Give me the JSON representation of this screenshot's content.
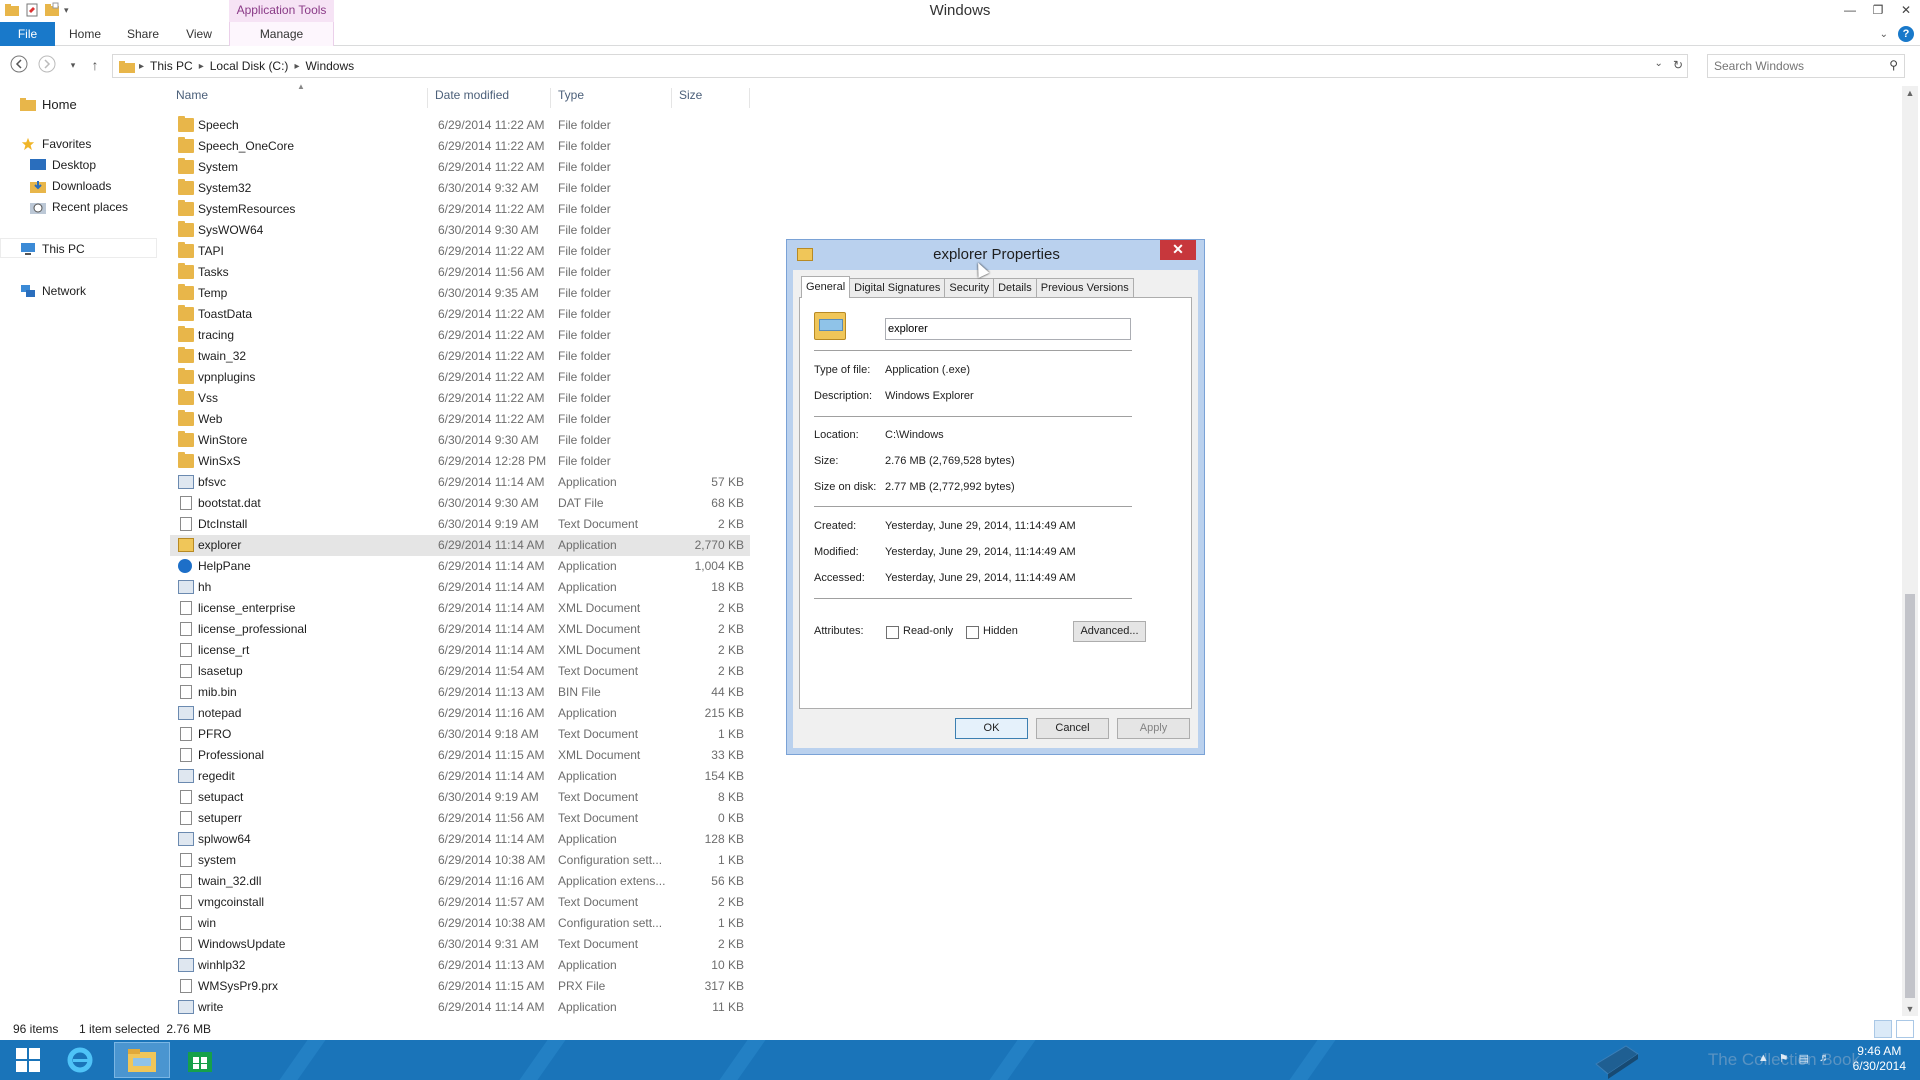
{
  "window": {
    "title": "Windows",
    "contextual_tab_group": "Application Tools"
  },
  "ribbon": {
    "tabs": [
      "File",
      "Home",
      "Share",
      "View",
      "Manage"
    ]
  },
  "address": {
    "crumbs": [
      "This PC",
      "Local Disk (C:)",
      "Windows"
    ],
    "search_placeholder": "Search Windows"
  },
  "nav": {
    "home": "Home",
    "favorites": "Favorites",
    "desktop": "Desktop",
    "downloads": "Downloads",
    "recent": "Recent places",
    "thispc": "This PC",
    "network": "Network"
  },
  "columns": {
    "name": "Name",
    "date": "Date modified",
    "type": "Type",
    "size": "Size"
  },
  "files": [
    {
      "name": "Speech",
      "date": "6/29/2014 11:22 AM",
      "type": "File folder",
      "size": "",
      "icon": "folder"
    },
    {
      "name": "Speech_OneCore",
      "date": "6/29/2014 11:22 AM",
      "type": "File folder",
      "size": "",
      "icon": "folder"
    },
    {
      "name": "System",
      "date": "6/29/2014 11:22 AM",
      "type": "File folder",
      "size": "",
      "icon": "folder"
    },
    {
      "name": "System32",
      "date": "6/30/2014 9:32 AM",
      "type": "File folder",
      "size": "",
      "icon": "folder"
    },
    {
      "name": "SystemResources",
      "date": "6/29/2014 11:22 AM",
      "type": "File folder",
      "size": "",
      "icon": "folder"
    },
    {
      "name": "SysWOW64",
      "date": "6/30/2014 9:30 AM",
      "type": "File folder",
      "size": "",
      "icon": "folder"
    },
    {
      "name": "TAPI",
      "date": "6/29/2014 11:22 AM",
      "type": "File folder",
      "size": "",
      "icon": "folder"
    },
    {
      "name": "Tasks",
      "date": "6/29/2014 11:56 AM",
      "type": "File folder",
      "size": "",
      "icon": "folder"
    },
    {
      "name": "Temp",
      "date": "6/30/2014 9:35 AM",
      "type": "File folder",
      "size": "",
      "icon": "folder"
    },
    {
      "name": "ToastData",
      "date": "6/29/2014 11:22 AM",
      "type": "File folder",
      "size": "",
      "icon": "folder"
    },
    {
      "name": "tracing",
      "date": "6/29/2014 11:22 AM",
      "type": "File folder",
      "size": "",
      "icon": "folder"
    },
    {
      "name": "twain_32",
      "date": "6/29/2014 11:22 AM",
      "type": "File folder",
      "size": "",
      "icon": "folder"
    },
    {
      "name": "vpnplugins",
      "date": "6/29/2014 11:22 AM",
      "type": "File folder",
      "size": "",
      "icon": "folder"
    },
    {
      "name": "Vss",
      "date": "6/29/2014 11:22 AM",
      "type": "File folder",
      "size": "",
      "icon": "folder"
    },
    {
      "name": "Web",
      "date": "6/29/2014 11:22 AM",
      "type": "File folder",
      "size": "",
      "icon": "folder"
    },
    {
      "name": "WinStore",
      "date": "6/30/2014 9:30 AM",
      "type": "File folder",
      "size": "",
      "icon": "folder"
    },
    {
      "name": "WinSxS",
      "date": "6/29/2014 12:28 PM",
      "type": "File folder",
      "size": "",
      "icon": "folder"
    },
    {
      "name": "bfsvc",
      "date": "6/29/2014 11:14 AM",
      "type": "Application",
      "size": "57 KB",
      "icon": "app"
    },
    {
      "name": "bootstat.dat",
      "date": "6/30/2014 9:30 AM",
      "type": "DAT File",
      "size": "68 KB",
      "icon": "doc"
    },
    {
      "name": "DtcInstall",
      "date": "6/30/2014 9:19 AM",
      "type": "Text Document",
      "size": "2 KB",
      "icon": "doc"
    },
    {
      "name": "explorer",
      "date": "6/29/2014 11:14 AM",
      "type": "Application",
      "size": "2,770 KB",
      "icon": "explorer",
      "selected": true
    },
    {
      "name": "HelpPane",
      "date": "6/29/2014 11:14 AM",
      "type": "Application",
      "size": "1,004 KB",
      "icon": "help"
    },
    {
      "name": "hh",
      "date": "6/29/2014 11:14 AM",
      "type": "Application",
      "size": "18 KB",
      "icon": "app"
    },
    {
      "name": "license_enterprise",
      "date": "6/29/2014 11:14 AM",
      "type": "XML Document",
      "size": "2 KB",
      "icon": "doc"
    },
    {
      "name": "license_professional",
      "date": "6/29/2014 11:14 AM",
      "type": "XML Document",
      "size": "2 KB",
      "icon": "doc"
    },
    {
      "name": "license_rt",
      "date": "6/29/2014 11:14 AM",
      "type": "XML Document",
      "size": "2 KB",
      "icon": "doc"
    },
    {
      "name": "lsasetup",
      "date": "6/29/2014 11:54 AM",
      "type": "Text Document",
      "size": "2 KB",
      "icon": "doc"
    },
    {
      "name": "mib.bin",
      "date": "6/29/2014 11:13 AM",
      "type": "BIN File",
      "size": "44 KB",
      "icon": "doc"
    },
    {
      "name": "notepad",
      "date": "6/29/2014 11:16 AM",
      "type": "Application",
      "size": "215 KB",
      "icon": "app"
    },
    {
      "name": "PFRO",
      "date": "6/30/2014 9:18 AM",
      "type": "Text Document",
      "size": "1 KB",
      "icon": "doc"
    },
    {
      "name": "Professional",
      "date": "6/29/2014 11:15 AM",
      "type": "XML Document",
      "size": "33 KB",
      "icon": "doc"
    },
    {
      "name": "regedit",
      "date": "6/29/2014 11:14 AM",
      "type": "Application",
      "size": "154 KB",
      "icon": "app"
    },
    {
      "name": "setupact",
      "date": "6/30/2014 9:19 AM",
      "type": "Text Document",
      "size": "8 KB",
      "icon": "doc"
    },
    {
      "name": "setuperr",
      "date": "6/29/2014 11:56 AM",
      "type": "Text Document",
      "size": "0 KB",
      "icon": "doc"
    },
    {
      "name": "splwow64",
      "date": "6/29/2014 11:14 AM",
      "type": "Application",
      "size": "128 KB",
      "icon": "app"
    },
    {
      "name": "system",
      "date": "6/29/2014 10:38 AM",
      "type": "Configuration sett...",
      "size": "1 KB",
      "icon": "doc"
    },
    {
      "name": "twain_32.dll",
      "date": "6/29/2014 11:16 AM",
      "type": "Application extens...",
      "size": "56 KB",
      "icon": "doc"
    },
    {
      "name": "vmgcoinstall",
      "date": "6/29/2014 11:57 AM",
      "type": "Text Document",
      "size": "2 KB",
      "icon": "doc"
    },
    {
      "name": "win",
      "date": "6/29/2014 10:38 AM",
      "type": "Configuration sett...",
      "size": "1 KB",
      "icon": "doc"
    },
    {
      "name": "WindowsUpdate",
      "date": "6/30/2014 9:31 AM",
      "type": "Text Document",
      "size": "2 KB",
      "icon": "doc"
    },
    {
      "name": "winhlp32",
      "date": "6/29/2014 11:13 AM",
      "type": "Application",
      "size": "10 KB",
      "icon": "app"
    },
    {
      "name": "WMSysPr9.prx",
      "date": "6/29/2014 11:15 AM",
      "type": "PRX File",
      "size": "317 KB",
      "icon": "doc"
    },
    {
      "name": "write",
      "date": "6/29/2014 11:14 AM",
      "type": "Application",
      "size": "11 KB",
      "icon": "app"
    }
  ],
  "status": {
    "items": "96 items",
    "selected": "1 item selected  2.76 MB"
  },
  "dialog": {
    "title": "explorer Properties",
    "tabs": [
      "General",
      "Digital Signatures",
      "Security",
      "Details",
      "Previous Versions"
    ],
    "file_name": "explorer",
    "type_label": "Type of file:",
    "type_value": "Application (.exe)",
    "desc_label": "Description:",
    "desc_value": "Windows Explorer",
    "location_label": "Location:",
    "location_value": "C:\\Windows",
    "size_label": "Size:",
    "size_value": "2.76 MB (2,769,528 bytes)",
    "disk_label": "Size on disk:",
    "disk_value": "2.77 MB (2,772,992 bytes)",
    "created_label": "Created:",
    "created_value": "Yesterday, June 29, 2014, 11:14:49 AM",
    "modified_label": "Modified:",
    "modified_value": "Yesterday, June 29, 2014, 11:14:49 AM",
    "accessed_label": "Accessed:",
    "accessed_value": "Yesterday, June 29, 2014, 11:14:49 AM",
    "attributes_label": "Attributes:",
    "readonly_label": "Read-only",
    "hidden_label": "Hidden",
    "advanced_label": "Advanced...",
    "ok_label": "OK",
    "cancel_label": "Cancel",
    "apply_label": "Apply"
  },
  "taskbar": {
    "watermark": "The Collection Book",
    "time": "9:46 AM",
    "date": "6/30/2014"
  }
}
